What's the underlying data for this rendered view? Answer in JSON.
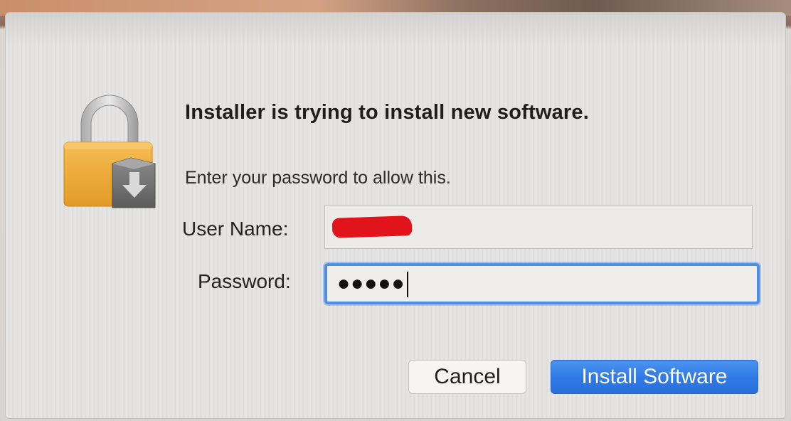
{
  "dialog": {
    "title": "Installer is trying to install new software.",
    "message": "Enter your password to allow this.",
    "icon": "lock-with-installer-icon"
  },
  "form": {
    "username_label": "User Name:",
    "username_value": "",
    "username_redacted": true,
    "password_label": "Password:",
    "password_masked": "●●●●●"
  },
  "buttons": {
    "cancel_label": "Cancel",
    "install_label": "Install Software"
  },
  "colors": {
    "accent": "#2f79e6",
    "focus_ring": "#4f8ee0",
    "lock_body": "#f0a93a",
    "redaction": "#e0141a"
  }
}
